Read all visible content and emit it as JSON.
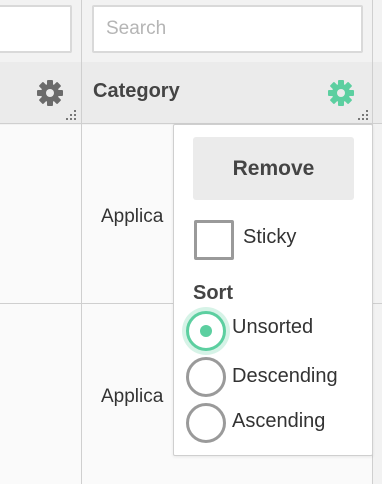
{
  "filters": {
    "left_value": "",
    "search_placeholder": "Search"
  },
  "header": {
    "column_title": "Category",
    "left_gear_icon": "gear-icon",
    "right_gear_icon": "gear-icon",
    "resize_icon": "resize-handle-icon",
    "accent_color": "#5ccfa0",
    "muted_icon_color": "#6b6b6b"
  },
  "rows": [
    {
      "category": "Applica"
    },
    {
      "category": "Applica"
    }
  ],
  "column_menu": {
    "remove_label": "Remove",
    "sticky_label": "Sticky",
    "sticky_checked": false,
    "sort_title": "Sort",
    "sort_options": [
      {
        "label": "Unsorted",
        "selected": true
      },
      {
        "label": "Descending",
        "selected": false
      },
      {
        "label": "Ascending",
        "selected": false
      }
    ]
  }
}
